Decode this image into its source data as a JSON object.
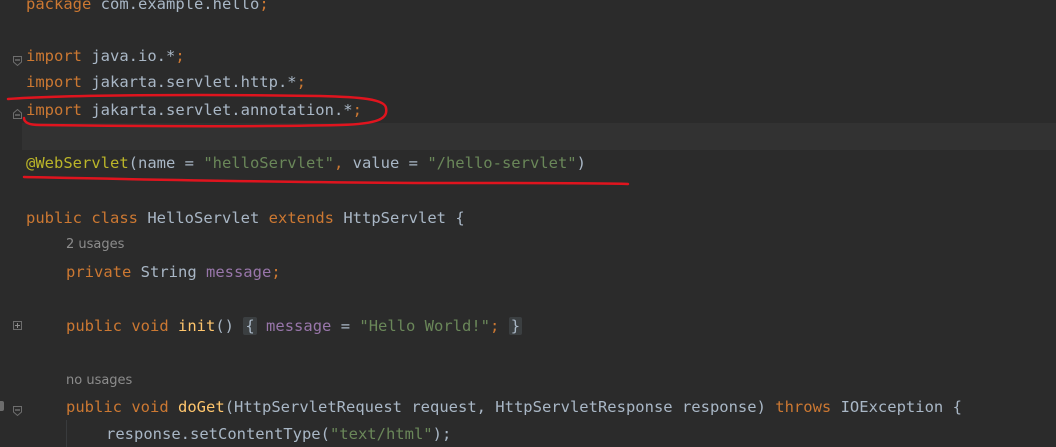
{
  "editor": {
    "line_package": {
      "kw": "package",
      "rest": " com.example.hello",
      "semi": ";"
    },
    "line_import1": {
      "kw": "import",
      "rest": " java.io.*",
      "semi": ";"
    },
    "line_import2": {
      "kw": "import",
      "rest": " jakarta.servlet.http.*",
      "semi": ";"
    },
    "line_import3": {
      "kw": "import",
      "rest": " jakarta.servlet.annotation.*",
      "semi": ";"
    },
    "line_annotation": {
      "ann": "@WebServlet",
      "open": "(name = ",
      "name_val": "\"helloServlet\"",
      "comma": ",",
      "mid": " value = ",
      "value_val": "\"/hello-servlet\"",
      "close": ")"
    },
    "line_class": {
      "kw1": "public",
      "kw2": "class",
      "name": " HelloServlet ",
      "kw3": "extends",
      "rest": " HttpServlet {"
    },
    "hint_usages": "2 usages",
    "line_field": {
      "kw": "private",
      "type": " String ",
      "name": "message",
      "semi": ";"
    },
    "line_init": {
      "kw1": "public",
      "kw2": "void",
      "fn": "init",
      "parens": "() ",
      "lbrace": "{",
      "field": "message",
      "eq": " = ",
      "str": "\"Hello World!\"",
      "semi": ";",
      "rbrace": "}"
    },
    "hint_no_usages": "no usages",
    "line_doget": {
      "kw1": "public",
      "kw2": "void",
      "fn": "doGet",
      "params": "(HttpServletRequest request, HttpServletResponse response) ",
      "kw3": "throws",
      "rest": " IOException {"
    },
    "line_content_type": {
      "call": "response.setContentType(",
      "str": "\"text/html\"",
      "close": ");"
    }
  },
  "colors": {
    "background": "#2b2b2b",
    "keyword": "#cc7832",
    "string": "#6a8759",
    "annotation": "#bbb529",
    "field": "#9876aa",
    "function": "#ffc66d",
    "markup_red": "#e0141e"
  }
}
